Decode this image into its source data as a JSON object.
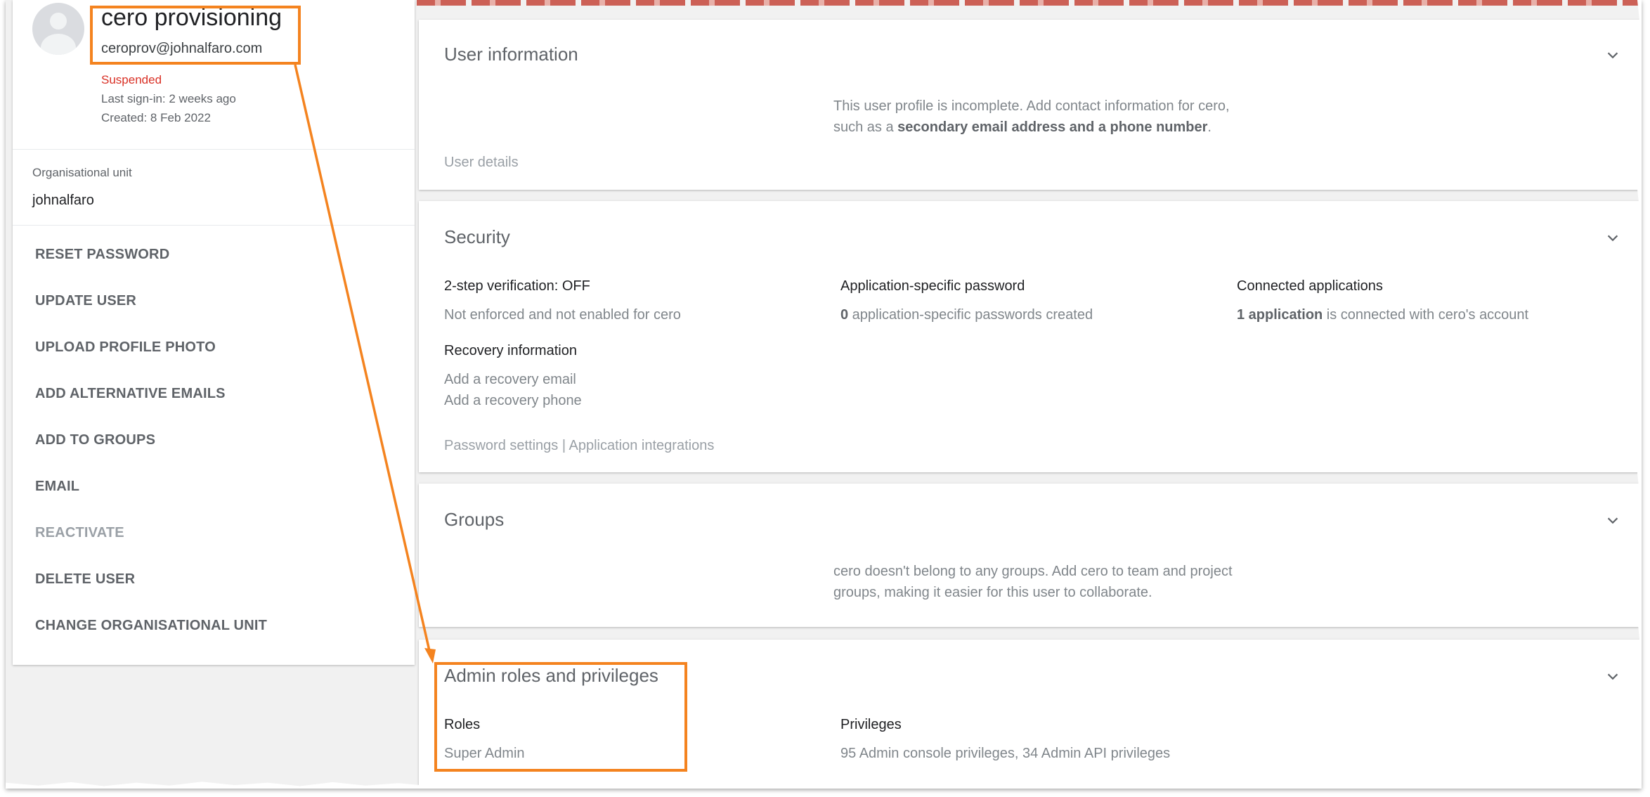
{
  "user": {
    "name": "cero provisioning",
    "email": "ceroprov@johnalfaro.com",
    "status": "Suspended",
    "last_signin": "Last sign-in: 2 weeks ago",
    "created": "Created: 8 Feb 2022"
  },
  "org_unit": {
    "label": "Organisational unit",
    "value": "johnalfaro"
  },
  "actions": [
    {
      "label": "RESET PASSWORD"
    },
    {
      "label": "UPDATE USER"
    },
    {
      "label": "UPLOAD PROFILE PHOTO"
    },
    {
      "label": "ADD ALTERNATIVE EMAILS"
    },
    {
      "label": "ADD TO GROUPS"
    },
    {
      "label": "EMAIL"
    },
    {
      "label": "REACTIVATE"
    },
    {
      "label": "DELETE USER"
    },
    {
      "label": "CHANGE ORGANISATIONAL UNIT"
    }
  ],
  "user_information": {
    "title": "User information",
    "message_part1": "This user profile is incomplete. Add contact information for cero, such as a ",
    "message_bold": "secondary email address and a phone number",
    "message_part2": ".",
    "link": "User details"
  },
  "security": {
    "title": "Security",
    "two_step_head": "2-step verification: OFF",
    "two_step_text": "Not enforced and not enabled for cero",
    "app_pw_head": "Application-specific password",
    "app_pw_count": "0",
    "app_pw_text": " application-specific passwords created",
    "connected_head": "Connected applications",
    "connected_bold": "1 application",
    "connected_text": " is connected with cero's account",
    "recovery_head": "Recovery information",
    "recovery_email": "Add a recovery email",
    "recovery_phone": "Add a recovery phone",
    "link_password": "Password settings",
    "link_sep": " | ",
    "link_integrations": "Application integrations"
  },
  "groups": {
    "title": "Groups",
    "message": "cero doesn't belong to any groups. Add cero to team and project groups, making it easier for this user to collaborate."
  },
  "admin_roles": {
    "title": "Admin roles and privileges",
    "roles_head": "Roles",
    "roles_value": "Super Admin",
    "priv_head": "Privileges",
    "priv_value": "95 Admin console privileges, 34 Admin API privileges"
  },
  "colors": {
    "highlight": "#f4831f",
    "suspended": "#d93025"
  },
  "icons": {
    "expand": "chevron-down-icon",
    "avatar": "person-avatar-icon"
  }
}
